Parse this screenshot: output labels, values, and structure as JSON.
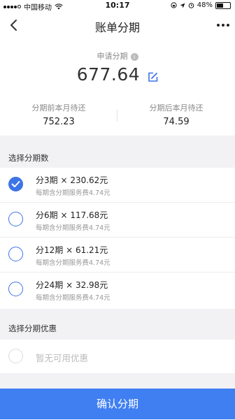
{
  "status_bar": {
    "carrier": "中国移动",
    "time": "10:17",
    "battery_percent": "48%",
    "battery_level": 0.48
  },
  "header": {
    "title": "账单分期"
  },
  "summary": {
    "apply_label": "申请分期",
    "amount": "677.64",
    "before_label": "分期前本月待还",
    "before_value": "752.23",
    "after_label": "分期后本月待还",
    "after_value": "74.59"
  },
  "installments": {
    "section_label": "选择分期数",
    "options": [
      {
        "title": "分3期 × 230.62元",
        "fee": "每期含分期服务费4.74元",
        "selected": true
      },
      {
        "title": "分6期 × 117.68元",
        "fee": "每期含分期服务费4.74元",
        "selected": false
      },
      {
        "title": "分12期 × 61.21元",
        "fee": "每期含分期服务费4.74元",
        "selected": false
      },
      {
        "title": "分24期 × 32.98元",
        "fee": "每期含分期服务费4.74元",
        "selected": false
      }
    ]
  },
  "discount": {
    "section_label": "选择分期优惠",
    "empty_text": "暂无可用优惠"
  },
  "footer": {
    "confirm_label": "确认分期"
  },
  "colors": {
    "accent": "#3d75e6",
    "confirm_bg": "#3f7ff2"
  }
}
